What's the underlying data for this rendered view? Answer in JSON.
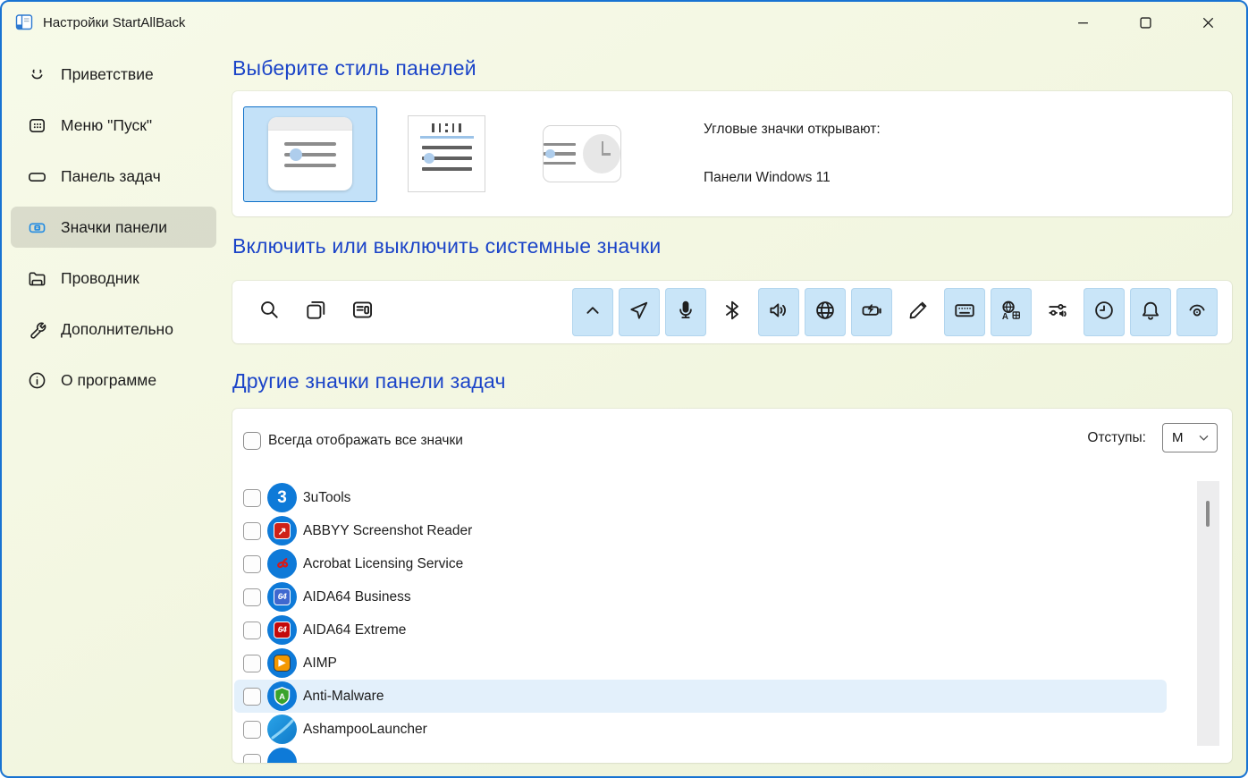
{
  "window": {
    "title": "Настройки StartAllBack",
    "controls": [
      "minimize",
      "maximize",
      "close"
    ]
  },
  "colors": {
    "window_border": "#1873d2",
    "heading": "#1b44c8",
    "toggle_on_bg": "#c9e5f8",
    "row_highlight": "#e3f0fb",
    "thumbnail_selected_bg": "#c3e1f8",
    "thumbnail_selected_border": "#0d6fc8",
    "app_circle_blue": "#0e7ad8"
  },
  "sidebar": {
    "items": [
      {
        "id": "welcome",
        "label": "Приветствие",
        "icon": "smiley-icon",
        "selected": false
      },
      {
        "id": "start-menu",
        "label": "Меню \"Пуск\"",
        "icon": "start-menu-icon",
        "selected": false
      },
      {
        "id": "taskbar",
        "label": "Панель задач",
        "icon": "taskbar-icon",
        "selected": false
      },
      {
        "id": "taskbar-icons",
        "label": "Значки панели",
        "icon": "panel-icons-icon",
        "selected": true
      },
      {
        "id": "explorer",
        "label": "Проводник",
        "icon": "folder-icon",
        "selected": false
      },
      {
        "id": "advanced",
        "label": "Дополнительно",
        "icon": "wrench-icon",
        "selected": false
      },
      {
        "id": "about",
        "label": "О программе",
        "icon": "info-icon",
        "selected": false
      }
    ]
  },
  "style_section": {
    "heading": "Выберите стиль панелей",
    "thumbnails": [
      {
        "name": "windows-11-panel-style",
        "selected": true
      },
      {
        "name": "taskbar-top-style",
        "selected": false
      },
      {
        "name": "clock-flyout-style",
        "selected": false
      }
    ],
    "corner_icons_label": "Угловые значки открывают:",
    "corner_icons_value": "Панели Windows 11"
  },
  "system_icons_section": {
    "heading": "Включить или выключить системные значки",
    "taskbar_buttons": [
      {
        "name": "search",
        "icon": "search-icon"
      },
      {
        "name": "task-view",
        "icon": "task-view-icon"
      },
      {
        "name": "widgets",
        "icon": "widgets-icon"
      }
    ],
    "tray_toggles": [
      {
        "name": "chevron-up",
        "icon": "chevron-up-icon",
        "enabled": true
      },
      {
        "name": "location",
        "icon": "location-icon",
        "enabled": true
      },
      {
        "name": "microphone",
        "icon": "microphone-icon",
        "enabled": true
      },
      {
        "name": "bluetooth",
        "icon": "bluetooth-icon",
        "enabled": false
      },
      {
        "name": "volume",
        "icon": "volume-icon",
        "enabled": true
      },
      {
        "name": "network",
        "icon": "network-globe-icon",
        "enabled": true
      },
      {
        "name": "battery",
        "icon": "battery-charging-icon",
        "enabled": true
      },
      {
        "name": "pen",
        "icon": "pen-icon",
        "enabled": false
      },
      {
        "name": "touch-keyboard",
        "icon": "touch-keyboard-icon",
        "enabled": true
      },
      {
        "name": "language",
        "icon": "language-icon",
        "enabled": true
      },
      {
        "name": "volume-mixer",
        "icon": "volume-mixer-icon",
        "enabled": false
      },
      {
        "name": "clock",
        "icon": "clock-icon",
        "enabled": true
      },
      {
        "name": "notifications",
        "icon": "bell-icon",
        "enabled": true
      },
      {
        "name": "eye",
        "icon": "eye-icon",
        "enabled": true
      }
    ]
  },
  "tray_apps_section": {
    "heading": "Другие значки панели задач",
    "always_show": {
      "label": "Всегда отображать все значки",
      "checked": false
    },
    "spacing": {
      "label": "Отступы:",
      "value": "M"
    },
    "apps": [
      {
        "label": "3uTools",
        "icon": "3utools",
        "checked": false,
        "highlighted": false
      },
      {
        "label": "ABBYY Screenshot Reader",
        "icon": "abbyy",
        "checked": false,
        "highlighted": false
      },
      {
        "label": "Acrobat Licensing Service",
        "icon": "acrobat",
        "checked": false,
        "highlighted": false
      },
      {
        "label": "AIDA64 Business",
        "icon": "aida-business",
        "checked": false,
        "highlighted": false
      },
      {
        "label": "AIDA64 Extreme",
        "icon": "aida-extreme",
        "checked": false,
        "highlighted": false
      },
      {
        "label": "AIMP",
        "icon": "aimp",
        "checked": false,
        "highlighted": false
      },
      {
        "label": "Anti-Malware",
        "icon": "antimalware",
        "checked": false,
        "highlighted": true
      },
      {
        "label": "AshampooLauncher",
        "icon": "ashampoo",
        "checked": false,
        "highlighted": false
      },
      {
        "label": "",
        "icon": "unknown",
        "checked": false,
        "highlighted": false,
        "partial": true
      }
    ]
  }
}
